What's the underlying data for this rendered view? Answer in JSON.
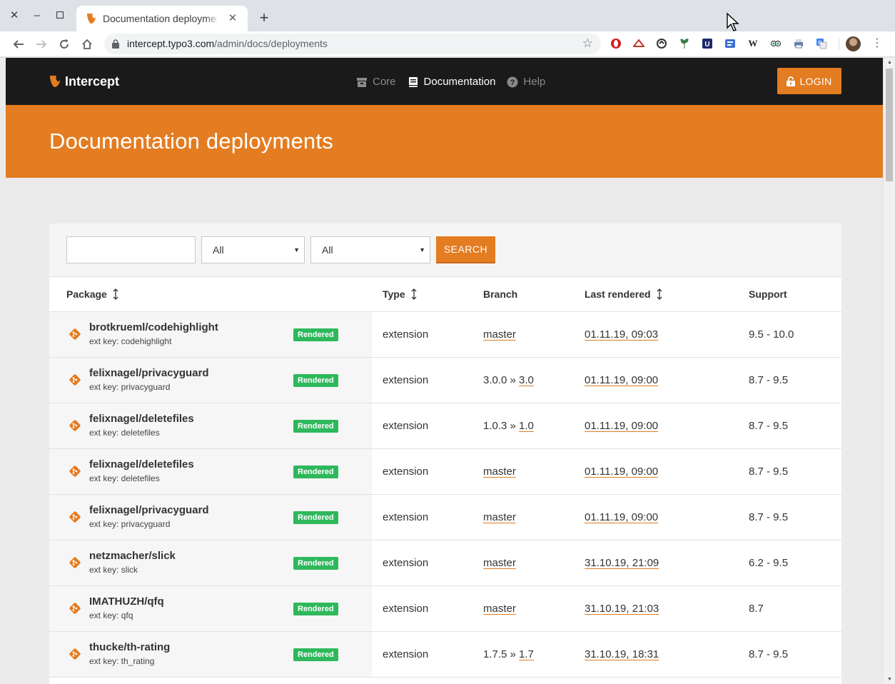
{
  "browser": {
    "tab_title": "Documentation deployments",
    "url_host": "intercept.typo3.com",
    "url_path": "/admin/docs/deployments"
  },
  "header": {
    "brand": "Intercept",
    "nav": [
      {
        "label": "Core",
        "icon": "box-icon"
      },
      {
        "label": "Documentation",
        "icon": "book-icon"
      },
      {
        "label": "Help",
        "icon": "question-circle-icon"
      }
    ],
    "login_label": "LOGIN"
  },
  "hero": {
    "title": "Documentation deployments"
  },
  "filters": {
    "search_value": "",
    "type_select": "All",
    "status_select": "All",
    "search_button": "SEARCH"
  },
  "table": {
    "columns": {
      "package": "Package",
      "type": "Type",
      "branch": "Branch",
      "last_rendered": "Last rendered",
      "support": "Support"
    },
    "rows": [
      {
        "package": "brotkrueml/codehighlight",
        "extkey": "ext key: codehighlight",
        "status": "Rendered",
        "type": "extension",
        "branch_prefix": "",
        "branch": "master",
        "date": "01.11.19, 09:03",
        "support": "9.5 - 10.0"
      },
      {
        "package": "felixnagel/privacyguard",
        "extkey": "ext key: privacyguard",
        "status": "Rendered",
        "type": "extension",
        "branch_prefix": "3.0.0 » ",
        "branch": "3.0",
        "date": "01.11.19, 09:00",
        "support": "8.7 - 9.5"
      },
      {
        "package": "felixnagel/deletefiles",
        "extkey": "ext key: deletefiles",
        "status": "Rendered",
        "type": "extension",
        "branch_prefix": "1.0.3 » ",
        "branch": "1.0",
        "date": "01.11.19, 09:00",
        "support": "8.7 - 9.5"
      },
      {
        "package": "felixnagel/deletefiles",
        "extkey": "ext key: deletefiles",
        "status": "Rendered",
        "type": "extension",
        "branch_prefix": "",
        "branch": "master",
        "date": "01.11.19, 09:00",
        "support": "8.7 - 9.5"
      },
      {
        "package": "felixnagel/privacyguard",
        "extkey": "ext key: privacyguard",
        "status": "Rendered",
        "type": "extension",
        "branch_prefix": "",
        "branch": "master",
        "date": "01.11.19, 09:00",
        "support": "8.7 - 9.5"
      },
      {
        "package": "netzmacher/slick",
        "extkey": "ext key: slick",
        "status": "Rendered",
        "type": "extension",
        "branch_prefix": "",
        "branch": "master",
        "date": "31.10.19, 21:09",
        "support": "6.2 - 9.5"
      },
      {
        "package": "IMATHUZH/qfq",
        "extkey": "ext key: qfq",
        "status": "Rendered",
        "type": "extension",
        "branch_prefix": "",
        "branch": "master",
        "date": "31.10.19, 21:03",
        "support": "8.7"
      },
      {
        "package": "thucke/th-rating",
        "extkey": "ext key: th_rating",
        "status": "Rendered",
        "type": "extension",
        "branch_prefix": "1.7.5 » ",
        "branch": "1.7",
        "date": "31.10.19, 18:31",
        "support": "8.7 - 9.5"
      }
    ]
  },
  "colors": {
    "accent": "#e47c21",
    "header_bg": "#1a1a1a",
    "badge_green": "#2eb85c"
  }
}
